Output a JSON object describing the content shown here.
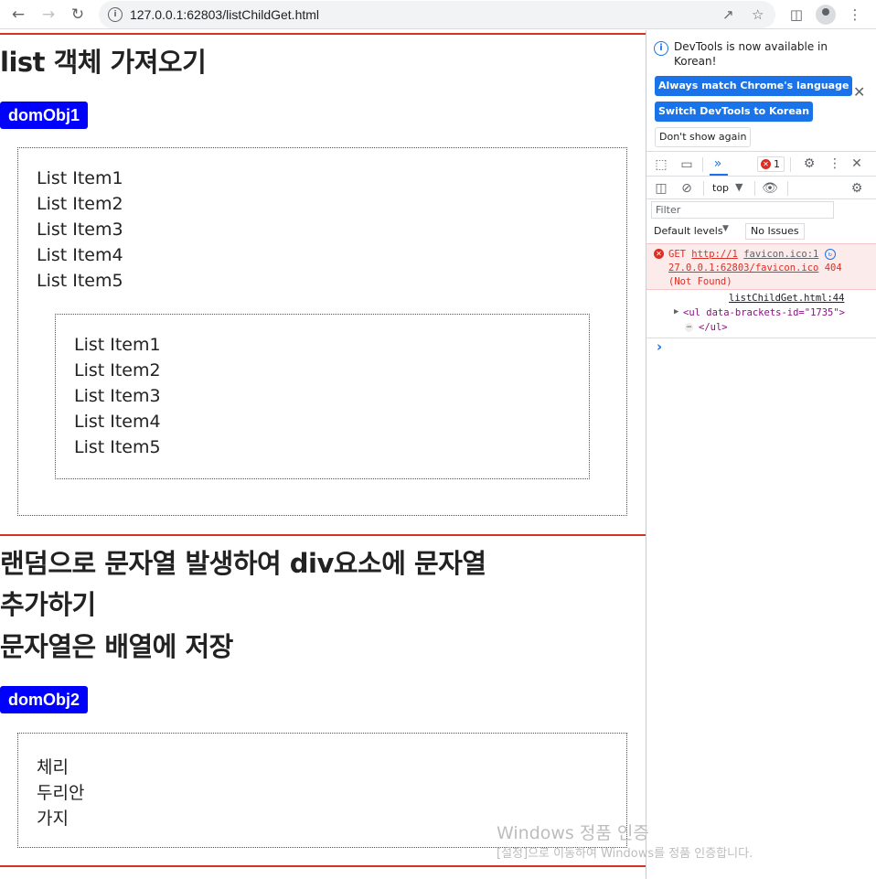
{
  "browser": {
    "url": "127.0.0.1:62803/listChildGet.html",
    "info_icon": "info-icon"
  },
  "page": {
    "section1": {
      "heading": "list 객체 가져오기",
      "button": "domObj1",
      "outer_items": [
        "List Item1",
        "List Item2",
        "List Item3",
        "List Item4",
        "List Item5"
      ],
      "inner_items": [
        "List Item1",
        "List Item2",
        "List Item3",
        "List Item4",
        "List Item5"
      ]
    },
    "section2": {
      "heading_line1": "랜덤으로 문자열 발생하여 div요소에 문자열",
      "heading_line2": "추가하기",
      "heading_line3": "문자열은 배열에 저장",
      "button": "domObj2",
      "items": [
        "체리",
        "두리안",
        "가지"
      ]
    },
    "colors": {
      "accent_rule": "#d93025",
      "button_bg": "#0000ff",
      "box_border": "#1a7a1a"
    }
  },
  "devtools": {
    "notice": "DevTools is now available in Korean!",
    "btn_match": "Always match Chrome's language",
    "btn_switch": "Switch DevTools to Korean",
    "btn_dont": "Don't show again",
    "error_count": "1",
    "context": "top",
    "filter_placeholder": "Filter",
    "levels": "Default levels",
    "issues": "No Issues",
    "error": {
      "method": "GET",
      "url1": "http://1",
      "url2": "27.0.0.1:62803/favicon.ico",
      "source": "favicon.ico:1",
      "status": "404",
      "status_text": "(Not Found)"
    },
    "log": {
      "source": "listChildGet.html:44",
      "element": "<ul data-brackets-id=\"1735\">",
      "ellipsis": "⋯",
      "close": "</ul>"
    },
    "prompt": "›"
  },
  "watermark": {
    "title": "Windows 정품 인증",
    "subtitle": "[설정]으로 이동하여 Windows를 정품 인증합니다."
  }
}
